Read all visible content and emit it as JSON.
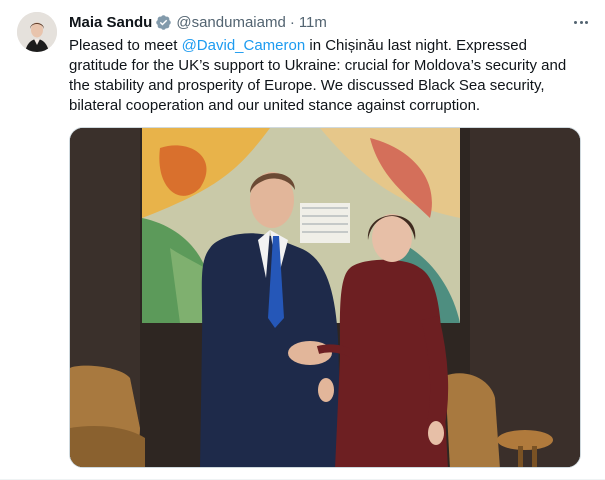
{
  "tweet": {
    "author_name": "Maia Sandu",
    "handle": "@sandumaiamd",
    "separator": "·",
    "time": "11m",
    "text_before": "Pleased to meet ",
    "mention": "@David_Cameron",
    "text_after": " in Chișinău last night. Expressed gratitude for the UK’s support to Ukraine: crucial for Moldova’s security and the stability and prosperity of Europe. We discussed Black Sea security, bilateral cooperation and our united stance against corruption."
  },
  "icons": {
    "verified": "verified-badge-icon",
    "more": "more-options-icon"
  },
  "colors": {
    "link": "#1d9bf0",
    "secondary_text": "#536471",
    "primary_text": "#0f1419",
    "border": "#cfd9de"
  }
}
